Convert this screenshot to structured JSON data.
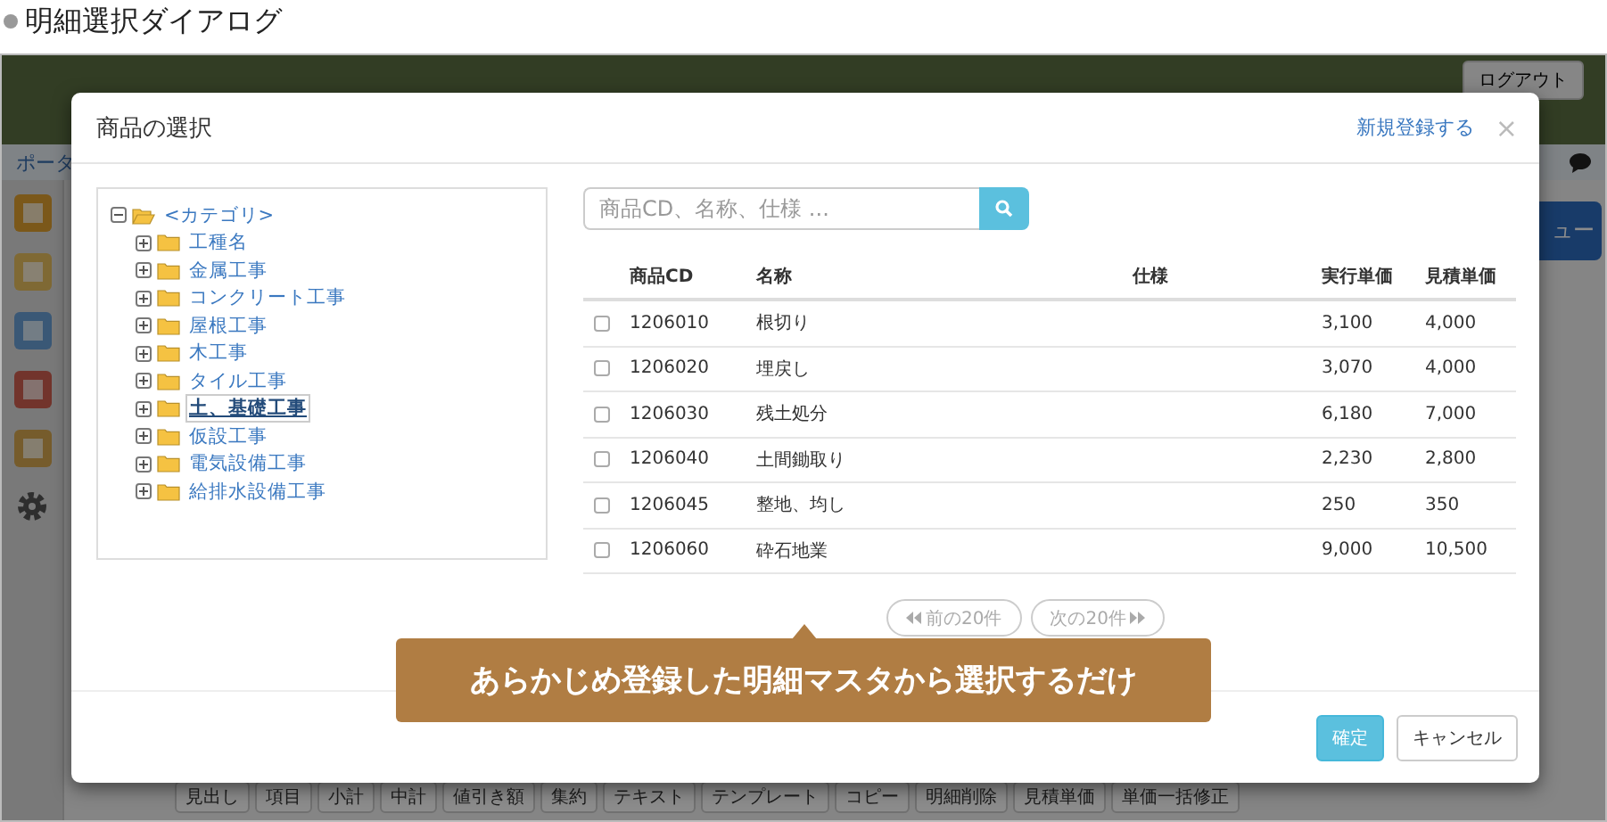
{
  "caption": "明細選択ダイアログ",
  "app": {
    "breadcrumb": "ポータ",
    "logout": "ログアウト",
    "menu_button": "ュー",
    "toolbar": [
      "見出し",
      "項目",
      "小計",
      "中計",
      "値引き額",
      "集約",
      "テキスト",
      "テンプレート",
      "コピー",
      "明細削除",
      "見積単価",
      "単価一括修正"
    ]
  },
  "dialog": {
    "title": "商品の選択",
    "new_link": "新規登録する",
    "close": "×",
    "tree": {
      "label": "<カテゴリ>",
      "expanded": true,
      "children": [
        {
          "label": "工種名",
          "expanded": false,
          "selected": false
        },
        {
          "label": "金属工事",
          "expanded": false,
          "selected": false
        },
        {
          "label": "コンクリート工事",
          "expanded": false,
          "selected": false
        },
        {
          "label": "屋根工事",
          "expanded": false,
          "selected": false
        },
        {
          "label": "木工事",
          "expanded": false,
          "selected": false
        },
        {
          "label": "タイル工事",
          "expanded": false,
          "selected": false
        },
        {
          "label": "土、基礎工事",
          "expanded": false,
          "selected": true
        },
        {
          "label": "仮設工事",
          "expanded": false,
          "selected": false
        },
        {
          "label": "電気設備工事",
          "expanded": false,
          "selected": false
        },
        {
          "label": "給排水設備工事",
          "expanded": false,
          "selected": false
        }
      ]
    },
    "search": {
      "placeholder": "商品CD、名称、仕様 ..."
    },
    "table": {
      "columns": [
        "商品CD",
        "名称",
        "仕様",
        "実行単価",
        "見積単価"
      ],
      "rows": [
        {
          "checked": false,
          "cells": [
            "1206010",
            "根切り",
            "",
            "3,100",
            "4,000"
          ]
        },
        {
          "checked": false,
          "cells": [
            "1206020",
            "埋戻し",
            "",
            "3,070",
            "4,000"
          ]
        },
        {
          "checked": false,
          "cells": [
            "1206030",
            "残土処分",
            "",
            "6,180",
            "7,000"
          ]
        },
        {
          "checked": false,
          "cells": [
            "1206040",
            "土間鋤取り",
            "",
            "2,230",
            "2,800"
          ]
        },
        {
          "checked": false,
          "cells": [
            "1206045",
            "整地、均し",
            "",
            "250",
            "350"
          ]
        },
        {
          "checked": false,
          "cells": [
            "1206060",
            "砕石地業",
            "",
            "9,000",
            "10,500"
          ]
        }
      ]
    },
    "pagination": {
      "prev": "前の20件",
      "next": "次の20件"
    },
    "buttons": {
      "ok": "確定",
      "cancel": "キャンセル"
    }
  },
  "callout": "あらかじめ登録した明細マスタから選択するだけ"
}
